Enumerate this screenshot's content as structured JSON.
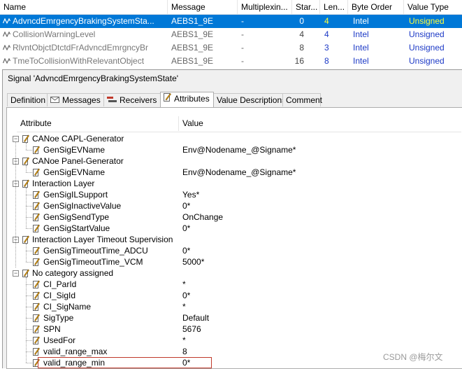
{
  "signal_table": {
    "columns": [
      "Name",
      "Message",
      "Multiplexin...",
      "Star...",
      "Len...",
      "Byte Order",
      "Value Type"
    ],
    "rows": [
      {
        "name": "AdvncdEmrgencyBrakingSystemSta...",
        "message": "AEBS1_9E",
        "mux": "-",
        "start": "0",
        "len": "4",
        "byte_order": "Intel",
        "value_type": "Unsigned",
        "selected": true
      },
      {
        "name": "CollisionWarningLevel",
        "message": "AEBS1_9E",
        "mux": "-",
        "start": "4",
        "len": "4",
        "byte_order": "Intel",
        "value_type": "Unsigned",
        "selected": false
      },
      {
        "name": "RlvntObjctDtctdFrAdvncdEmrgncyBr",
        "message": "AEBS1_9E",
        "mux": "-",
        "start": "8",
        "len": "3",
        "byte_order": "Intel",
        "value_type": "Unsigned",
        "selected": false
      },
      {
        "name": "TmeToCollisionWithRelevantObject",
        "message": "AEBS1_9E",
        "mux": "-",
        "start": "16",
        "len": "8",
        "byte_order": "Intel",
        "value_type": "Unsigned",
        "selected": false
      }
    ]
  },
  "dialog": {
    "title": "Signal 'AdvncdEmrgencyBrakingSystemState'",
    "tabs": [
      {
        "label": "Definition",
        "icon": "none",
        "active": false
      },
      {
        "label": "Messages",
        "icon": "envelope-icon",
        "active": false
      },
      {
        "label": "Receivers",
        "icon": "receivers-icon",
        "active": false
      },
      {
        "label": "Attributes",
        "icon": "pencil-icon",
        "active": true
      },
      {
        "label": "Value Descriptions",
        "icon": "none",
        "active": false
      },
      {
        "label": "Comment",
        "icon": "none",
        "active": false
      }
    ],
    "grid_headers": {
      "attribute": "Attribute",
      "value": "Value"
    },
    "groups": [
      {
        "label": "CANoe CAPL-Generator",
        "items": [
          {
            "name": "GenSigEVName",
            "value": "Env@Nodename_@Signame*"
          }
        ]
      },
      {
        "label": "CANoe Panel-Generator",
        "items": [
          {
            "name": "GenSigEVName",
            "value": "Env@Nodename_@Signame*"
          }
        ]
      },
      {
        "label": "Interaction Layer",
        "items": [
          {
            "name": "GenSigILSupport",
            "value": "Yes*"
          },
          {
            "name": "GenSigInactiveValue",
            "value": "0*"
          },
          {
            "name": "GenSigSendType",
            "value": "OnChange"
          },
          {
            "name": "GenSigStartValue",
            "value": "0*"
          }
        ]
      },
      {
        "label": "Interaction Layer Timeout Supervision",
        "items": [
          {
            "name": "GenSigTimeoutTime_ADCU",
            "value": "0*"
          },
          {
            "name": "GenSigTimeoutTime_VCM",
            "value": "5000*"
          }
        ]
      },
      {
        "label": "No category assigned",
        "items": [
          {
            "name": "CI_ParId",
            "value": "*"
          },
          {
            "name": "CI_SigId",
            "value": "0*"
          },
          {
            "name": "CI_SigName",
            "value": "*"
          },
          {
            "name": "SigType",
            "value": "Default"
          },
          {
            "name": "SPN",
            "value": "5676",
            "highlighted": true
          },
          {
            "name": "UsedFor",
            "value": "*"
          },
          {
            "name": "valid_range_max",
            "value": "8"
          },
          {
            "name": "valid_range_min",
            "value": "0*"
          }
        ]
      }
    ]
  },
  "watermark": "CSDN @梅尔文",
  "colors": {
    "selection": "#0078d7",
    "value_blue": "#1c39c6",
    "selected_highlight": "#ffff3a",
    "highlight_box": "#c0392b"
  }
}
